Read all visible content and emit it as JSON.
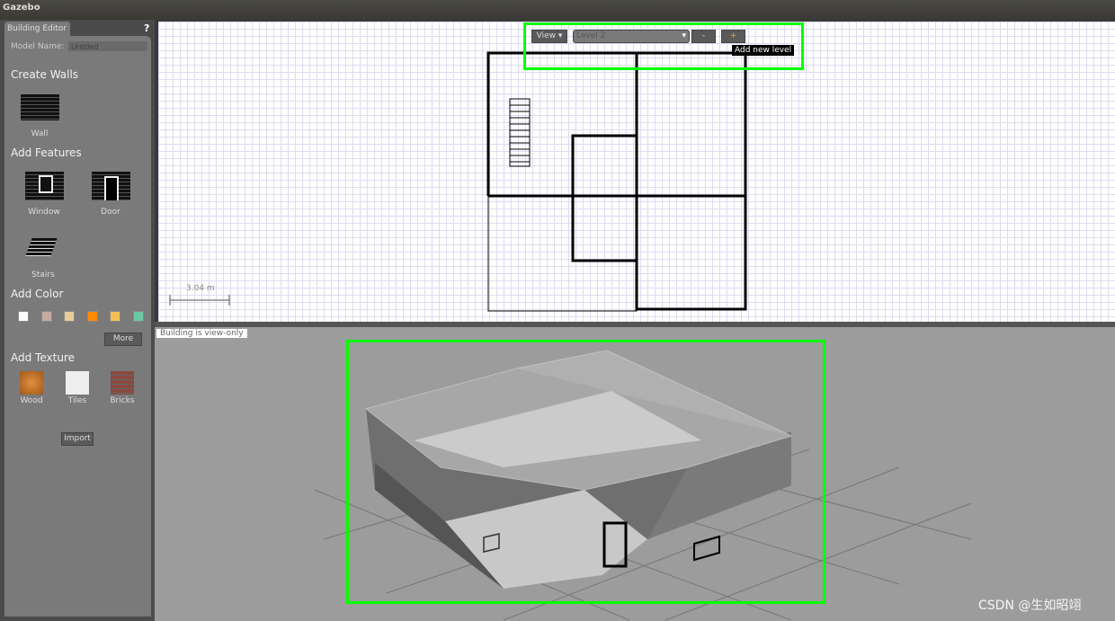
{
  "window": {
    "title": "Gazebo"
  },
  "left_panel": {
    "tab": "Building Editor",
    "help": "?",
    "model_name_label": "Model Name:",
    "model_name_value": "Untitled",
    "create_walls": "Create Walls",
    "wall": "Wall",
    "add_features": "Add Features",
    "window": "Window",
    "door": "Door",
    "stairs": "Stairs",
    "add_color": "Add Color",
    "colors": [
      "#ffffff",
      "#c8aaa4",
      "#e8cc98",
      "#ff8a00",
      "#f5be55",
      "#6cc8a4"
    ],
    "more": "More",
    "add_texture": "Add Texture",
    "wood": "Wood",
    "tiles": "Tiles",
    "bricks": "Bricks",
    "import": "Import"
  },
  "toolbar": {
    "view": "View",
    "level": "Level 2",
    "minus": "-",
    "plus": "+",
    "tooltip": "Add new level"
  },
  "editor2d": {
    "scale": "3.04 m"
  },
  "view3d": {
    "status": "Building is view-only"
  },
  "highlight_color": "#00ff00",
  "watermark": "CSDN @生如昭翊"
}
